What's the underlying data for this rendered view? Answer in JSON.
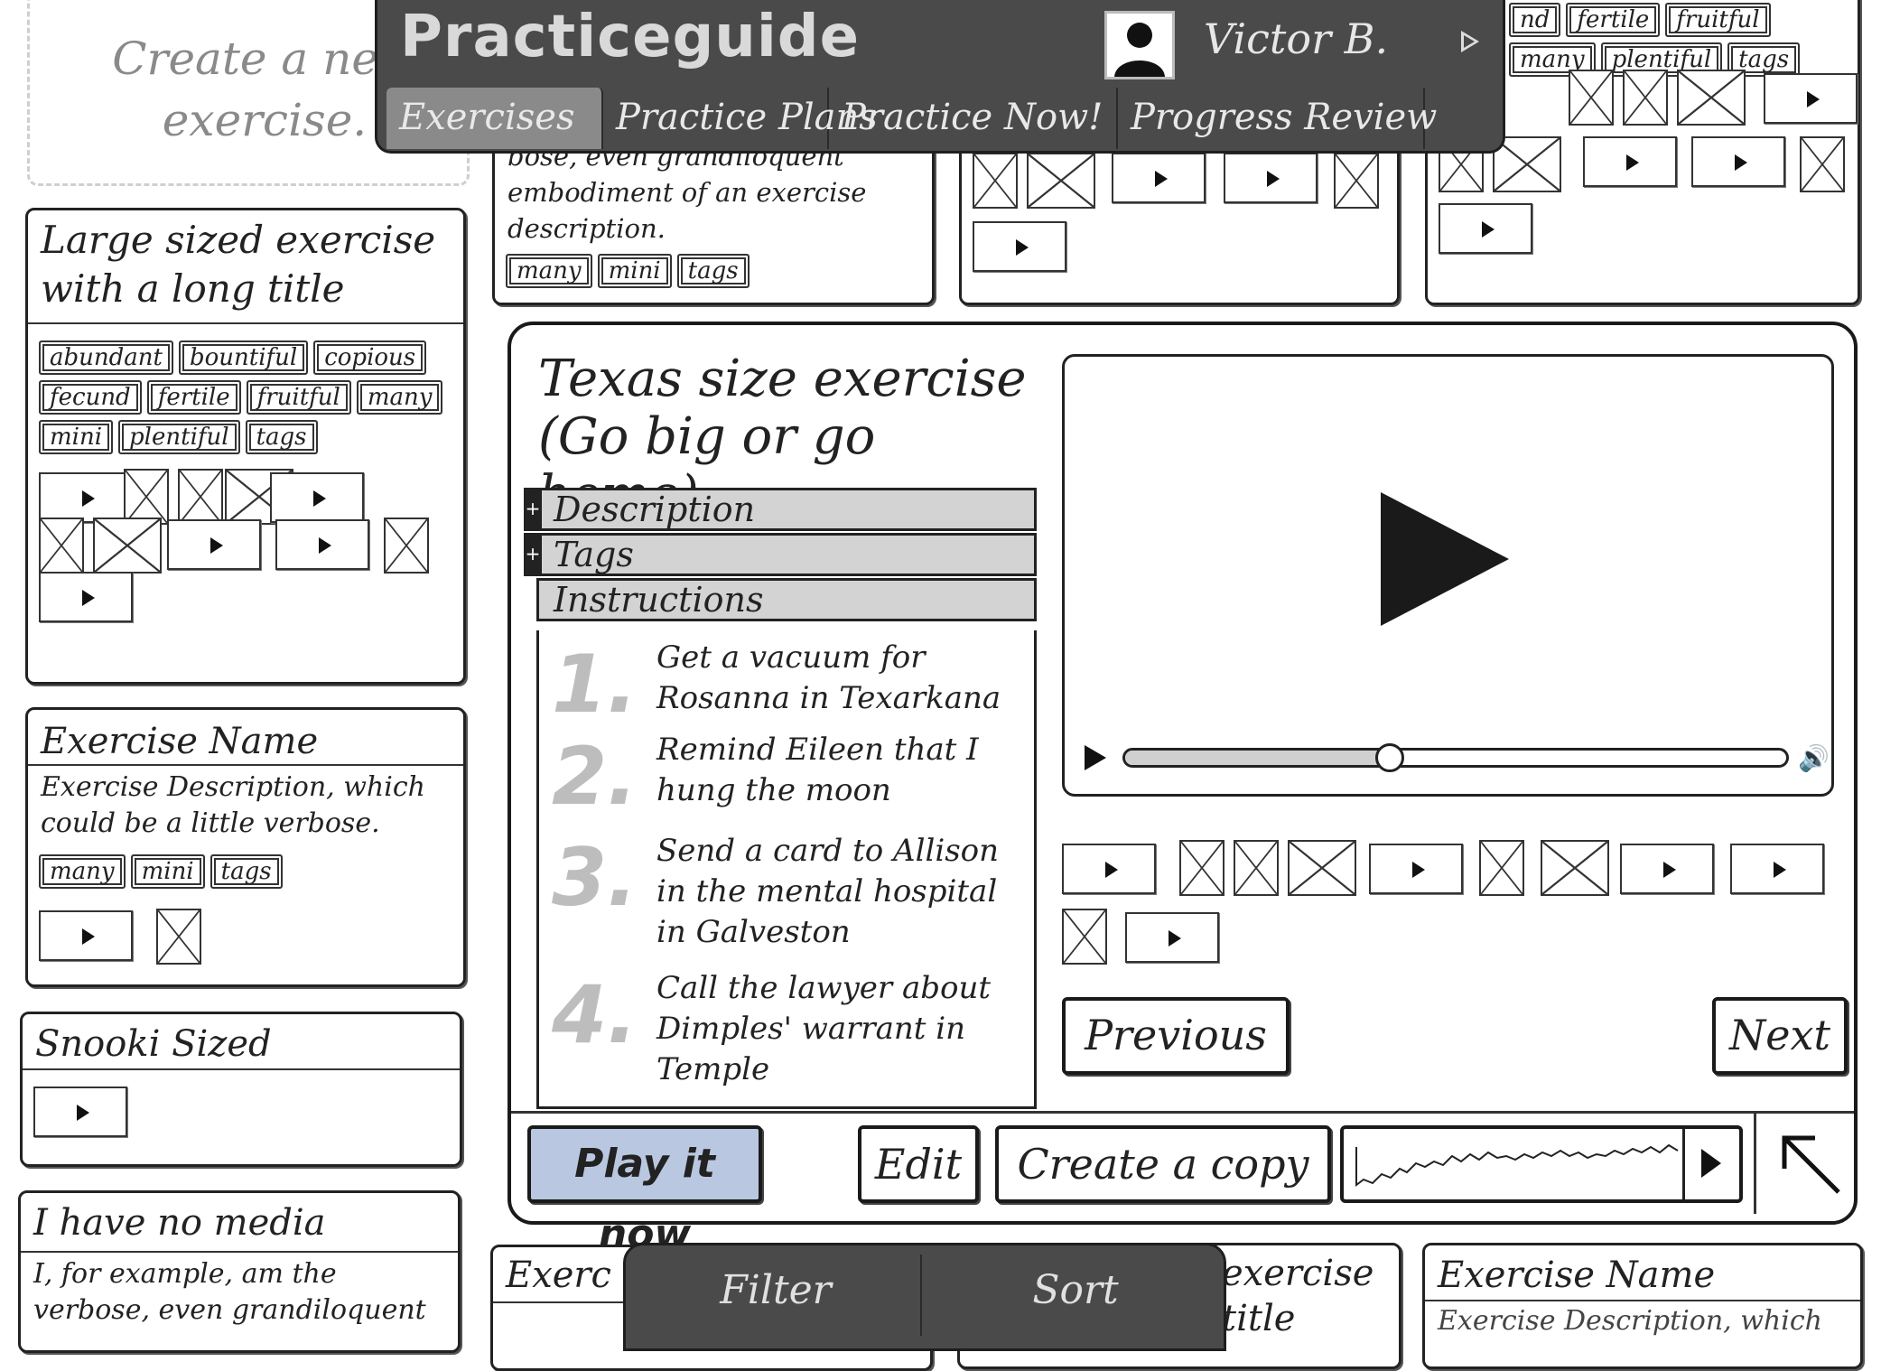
{
  "app": {
    "brand": "Practiceguide",
    "user": "Victor B.",
    "tabs": [
      "Exercises",
      "Practice Plans",
      "Practice Now!",
      "Progress Review"
    ],
    "active_tab": 0
  },
  "create_new": {
    "text": "Create a new exercise."
  },
  "cards": {
    "large": {
      "title": "Large sized exercise with a long title",
      "tags": [
        "abundant",
        "bountiful",
        "copious",
        "fecund",
        "fertile",
        "fruitful",
        "many",
        "mini",
        "plentiful",
        "tags"
      ]
    },
    "medium": {
      "title": "Exercise Name",
      "description": "Exercise Description, which could be a little verbose.",
      "tags": [
        "many",
        "mini",
        "tags"
      ]
    },
    "snooki": {
      "title": "Snooki Sized"
    },
    "nomedia": {
      "title": "I have no media",
      "description": "I, for example, am the verbose, even grandiloquent"
    },
    "top_middle": {
      "description": "bose, even grandiloquent embodiment of an exercise description.",
      "tags": [
        "many",
        "mini",
        "tags"
      ]
    },
    "top_right": {
      "tags": [
        "nd",
        "fertile",
        "fruitful",
        "many",
        "plentiful",
        "tags"
      ]
    },
    "bottom": {
      "c1": "Exerc",
      "c2": "exercise",
      "c2b": "title",
      "c3": "Exercise Name",
      "c3b": "Exercise Description, which"
    }
  },
  "detail": {
    "title": "Texas size exercise (Go big or go home)",
    "sections": [
      "Description",
      "Tags",
      "Instructions"
    ],
    "steps": [
      {
        "num": "1.",
        "text": "Get a vacuum for Rosanna in Texarkana"
      },
      {
        "num": "2.",
        "text": "Remind Eileen that I hung the moon"
      },
      {
        "num": "3.",
        "text": "Send a card to Allison in the mental hospital in Galveston"
      },
      {
        "num": "4.",
        "text": "Call the lawyer about Dimples' warrant in Temple"
      }
    ],
    "video_progress": 0.4,
    "previous": "Previous",
    "next": "Next",
    "actions": {
      "play": "Play it now",
      "edit": "Edit",
      "copy": "Create a copy"
    }
  },
  "bottom_bar": {
    "filter": "Filter",
    "sort": "Sort"
  }
}
